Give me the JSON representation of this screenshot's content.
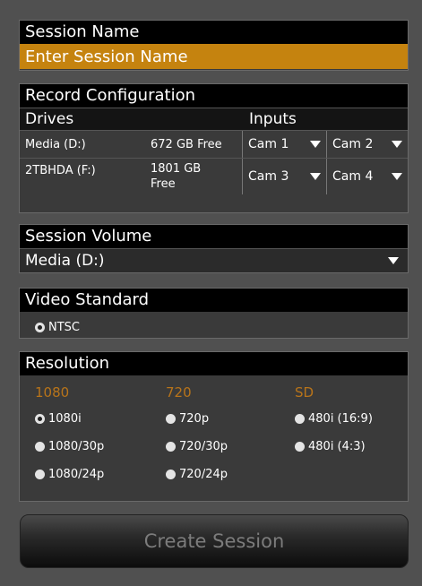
{
  "session_name": {
    "header": "Session Name",
    "placeholder": "Enter Session Name"
  },
  "record_config": {
    "header": "Record Configuration",
    "drives_label": "Drives",
    "inputs_label": "Inputs",
    "drives": [
      {
        "name": "Media (D:)",
        "free": "672 GB Free",
        "cams": [
          "Cam 1",
          "Cam 2"
        ]
      },
      {
        "name": "2TBHDA (F:)",
        "free": "1801 GB Free",
        "cams": [
          "Cam 3",
          "Cam 4"
        ]
      }
    ]
  },
  "session_volume": {
    "header": "Session Volume",
    "selected": "Media (D:)"
  },
  "video_standard": {
    "header": "Video Standard",
    "option": "NTSC",
    "selected": true
  },
  "resolution": {
    "header": "Resolution",
    "groups": [
      {
        "title": "1080",
        "options": [
          "1080i",
          "1080/30p",
          "1080/24p"
        ]
      },
      {
        "title": "720",
        "options": [
          "720p",
          "720/30p",
          "720/24p"
        ]
      },
      {
        "title": "SD",
        "options": [
          "480i (16:9)",
          "480i (4:3)"
        ]
      }
    ],
    "selected": "1080i"
  },
  "create_button": "Create Session",
  "colors": {
    "accent": "#c5830f",
    "group_title": "#b8741a",
    "background": "#505050"
  }
}
